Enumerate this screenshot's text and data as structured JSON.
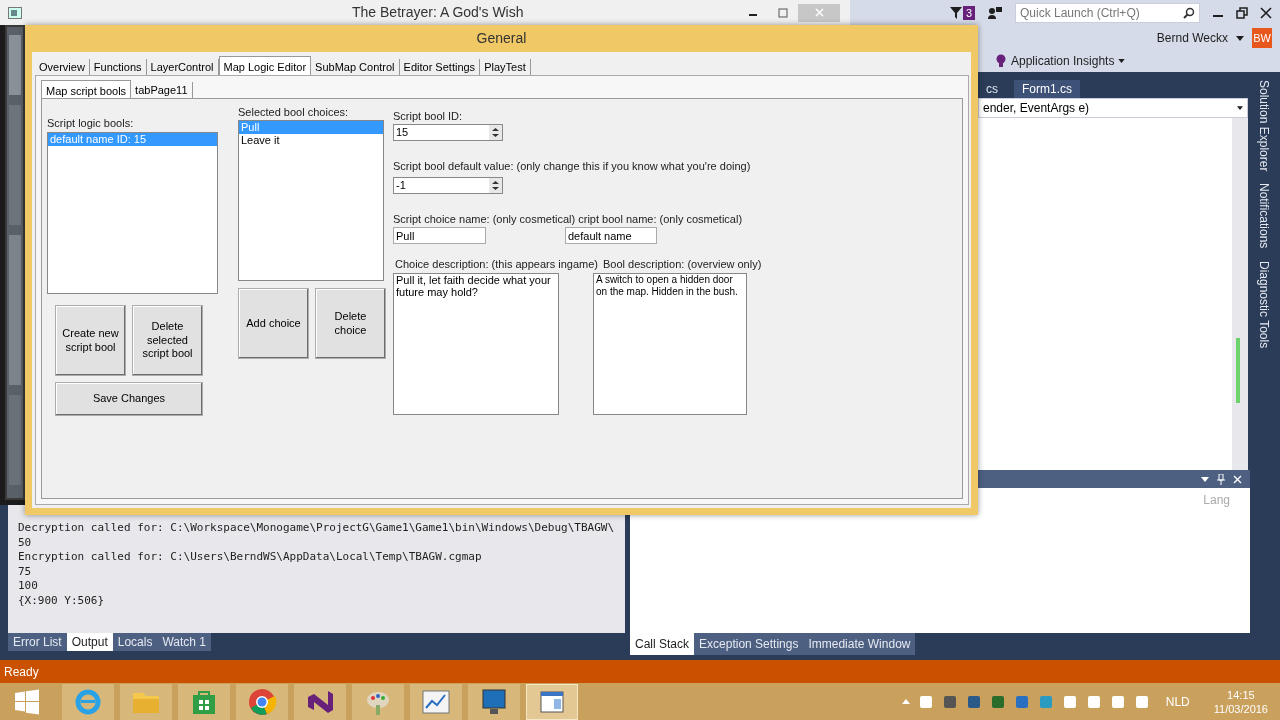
{
  "game_window": {
    "title": "The Betrayer: A God's Wish"
  },
  "dialog": {
    "title": "General",
    "tabs": [
      {
        "label": "Overview",
        "selected": false
      },
      {
        "label": "Functions",
        "selected": false
      },
      {
        "label": "LayerControl",
        "selected": false
      },
      {
        "label": "Map Logic Editor",
        "selected": true
      },
      {
        "label": "SubMap Control",
        "selected": false
      },
      {
        "label": "Editor Settings",
        "selected": false
      },
      {
        "label": "PlayTest",
        "selected": false
      }
    ],
    "subtabs": [
      {
        "label": "Map script bools",
        "selected": true
      },
      {
        "label": "tabPage11",
        "selected": false
      }
    ],
    "bools_label": "Script logic bools:",
    "bools": [
      {
        "label": "default name ID: 15",
        "selected": true
      }
    ],
    "create_button": "Create new script bool",
    "delete_bool_button": "Delete selected script bool",
    "save_button": "Save Changes",
    "choices_label": "Selected bool  choices:",
    "choices": [
      {
        "label": "Pull",
        "selected": true
      },
      {
        "label": "Leave it",
        "selected": false
      }
    ],
    "add_choice_button": "Add choice",
    "delete_choice_button": "Delete choice",
    "id_field": {
      "label": "Script bool ID:",
      "value": "15"
    },
    "default_field": {
      "label": "Script bool default value: (only change this if you know what you're doing)",
      "value": "-1"
    },
    "names_label": "Script choice name: (only cosmetical) cript bool name: (only cosmetical)",
    "choice_name": "Pull",
    "bool_name": "default name",
    "choice_desc": {
      "label": "Choice description: (this appears ingame)",
      "value": "Pull it, let faith decide what your future may hold?"
    },
    "bool_desc": {
      "label": "Bool description: (overview only)",
      "value": "A switch to open a hidden door on the map. Hidden in the bush."
    }
  },
  "vs": {
    "notification_count": "3",
    "quick_launch_placeholder": "Quick Launch (Ctrl+Q)",
    "user": "Bernd Weckx",
    "avatar": "BW",
    "insights": "Application Insights",
    "doc_tabs": [
      {
        "label": "cs",
        "selected": false
      },
      {
        "label": "Form1.cs",
        "selected": true
      }
    ],
    "member_dropdown": "ender, EventArgs e)",
    "side_tabs": [
      "Solution Explorer",
      "Notifications",
      "Diagnostic Tools"
    ],
    "output_lines": [
      "Decryption called for: C:\\Workspace\\Monogame\\ProjectG\\Game1\\Game1\\bin\\Windows\\Debug\\TBAGW\\",
      "50",
      "Encryption called for: C:\\Users\\BerndWS\\AppData\\Local\\Temp\\TBAGW.cgmap",
      "75",
      "100",
      "{X:900 Y:506}"
    ],
    "output_tabs": [
      {
        "label": "Error List",
        "selected": false
      },
      {
        "label": "Output",
        "selected": true
      },
      {
        "label": "Locals",
        "selected": false
      },
      {
        "label": "Watch 1",
        "selected": false
      }
    ],
    "callstack_column": "Lang",
    "debug_tabs": [
      {
        "label": "Call Stack",
        "selected": true
      },
      {
        "label": "Exception Settings",
        "selected": false
      },
      {
        "label": "Immediate Window",
        "selected": false
      }
    ],
    "status": "Ready"
  },
  "taskbar": {
    "apps": [
      {
        "kind": "ie",
        "selected": false
      },
      {
        "kind": "folder",
        "selected": false
      },
      {
        "kind": "store",
        "selected": false
      },
      {
        "kind": "chrome",
        "selected": false
      },
      {
        "kind": "vs",
        "selected": false
      },
      {
        "kind": "paint",
        "selected": false
      },
      {
        "kind": "chart",
        "selected": false
      },
      {
        "kind": "monitor",
        "selected": false
      },
      {
        "kind": "window",
        "selected": true
      }
    ],
    "language": "NLD",
    "time": "14:15",
    "date": "11/03/2016"
  }
}
